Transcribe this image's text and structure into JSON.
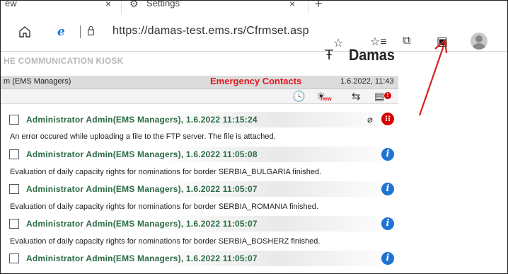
{
  "tabs": [
    {
      "label": "ew",
      "close": "×"
    },
    {
      "label": "Settings",
      "close": "×",
      "icon": "gear-icon"
    }
  ],
  "new_tab": "+",
  "address": {
    "url": "https://damas-test.ems.rs/Cfrmset.asp"
  },
  "page": {
    "kiosk_title": "HE COMMUNICATION KIOSK",
    "logo_text": "Damas",
    "user": "m (EMS Managers)",
    "section_title": "Emergency Contacts",
    "datetime": "1.6.2022, 11:43",
    "new_badge": "new"
  },
  "messages": [
    {
      "sender": "Administrator Admin(EMS Managers), 1.6.2022 11:15:24",
      "body": "An error occured while uploading a file to the FTP server. The file is attached.",
      "type": "error",
      "attachment": true
    },
    {
      "sender": "Administrator Admin(EMS Managers), 1.6.2022 11:05:08",
      "body": "Evaluation of daily capacity rights for nominations for border SERBIA_BULGARIA finished.",
      "type": "info"
    },
    {
      "sender": "Administrator Admin(EMS Managers), 1.6.2022 11:05:07",
      "body": "Evaluation of daily capacity rights for nominations for border SERBIA_ROMANIA finished.",
      "type": "info"
    },
    {
      "sender": "Administrator Admin(EMS Managers), 1.6.2022 11:05:07",
      "body": "Evaluation of daily capacity rights for nominations for border SERBIA_BOSHERZ finished.",
      "type": "info"
    },
    {
      "sender": "Administrator Admin(EMS Managers), 1.6.2022 11:05:07",
      "body": "",
      "type": "info"
    }
  ],
  "colors": {
    "accent": "#e0181e",
    "sender": "#2b6b45",
    "info": "#1e74d2",
    "annotation": "#d42020"
  }
}
